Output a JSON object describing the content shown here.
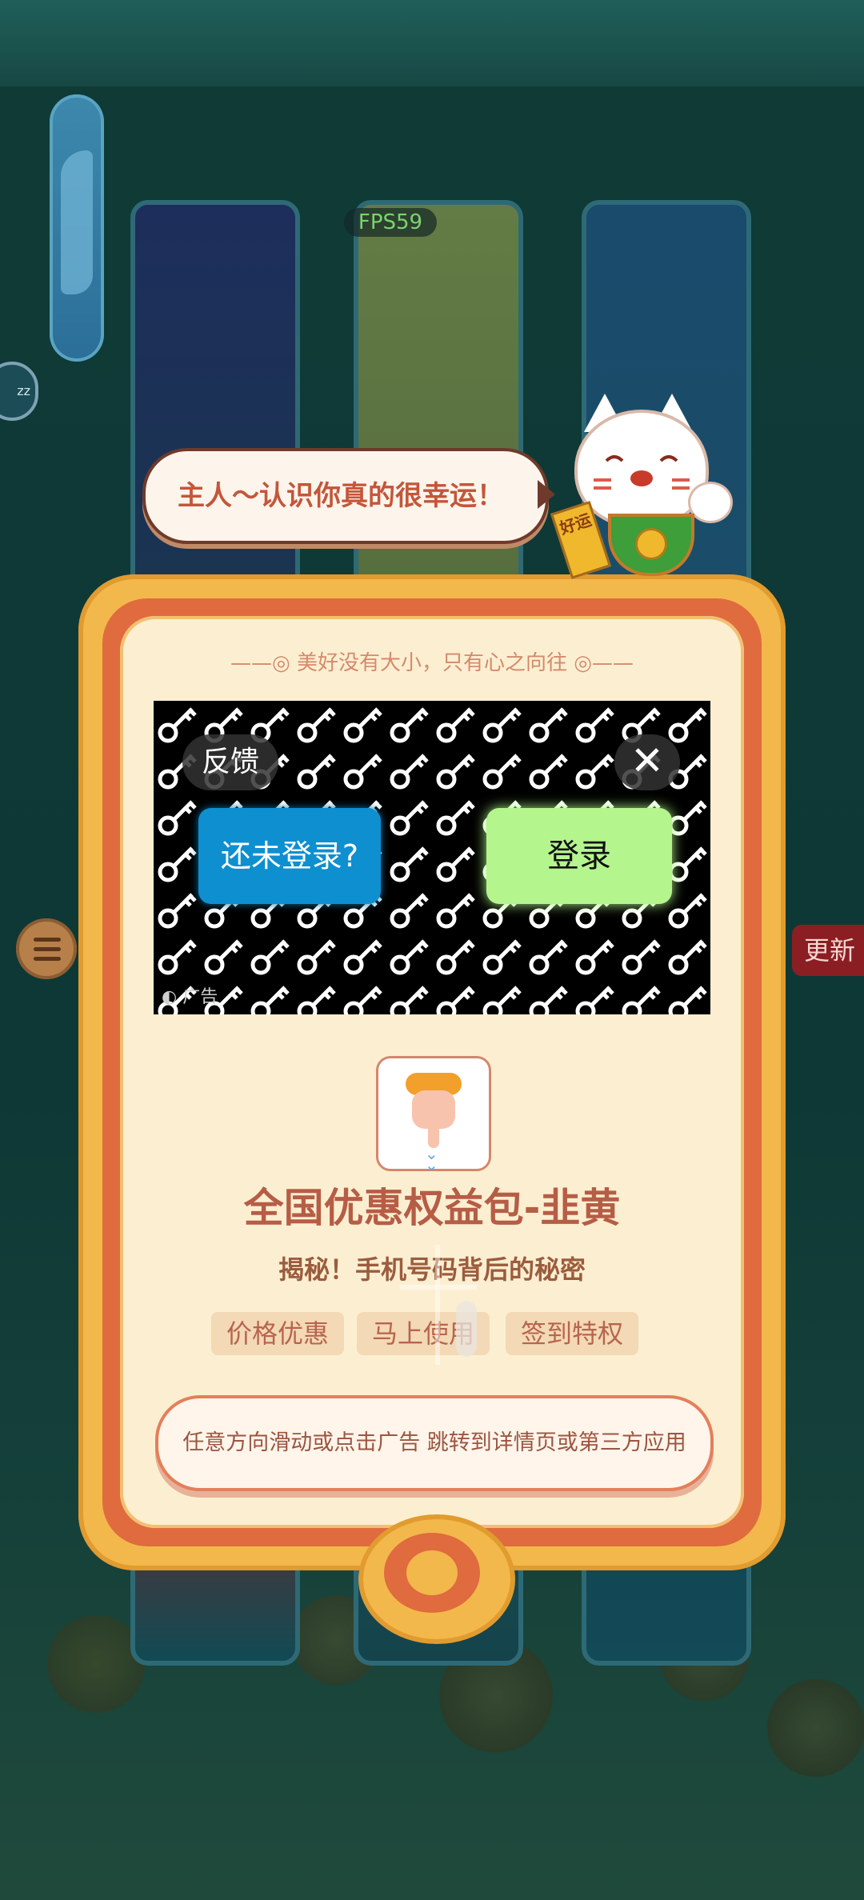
{
  "hud": {
    "fps": "FPS59",
    "update_label": "更新",
    "side_badge": "zz"
  },
  "bubble": {
    "text": "主人～认识你真的很幸运！"
  },
  "cat": {
    "tag": "好运"
  },
  "dialog": {
    "motto": "美好没有大小，只有心之向往",
    "ad": {
      "feedback_label": "反馈",
      "close_label": "✕",
      "not_logged_label": "还未登录?",
      "login_label": "登录",
      "ad_label": "广告"
    },
    "product": {
      "title": "全国优惠权益包-韭黄",
      "subtitle": "揭秘！手机号码背后的秘密",
      "tags": [
        "价格优惠",
        "马上使用",
        "签到特权"
      ]
    },
    "cta": "任意方向滑动或点击广告 跳转到详情页或第三方应用"
  },
  "colors": {
    "frame_gold": "#f3b84b",
    "frame_orange": "#e06b3f",
    "inner_cream": "#fcefd1",
    "title_brown": "#b65d46",
    "login_green": "#b4f58e",
    "not_logged_blue": "#0e8fd0"
  }
}
